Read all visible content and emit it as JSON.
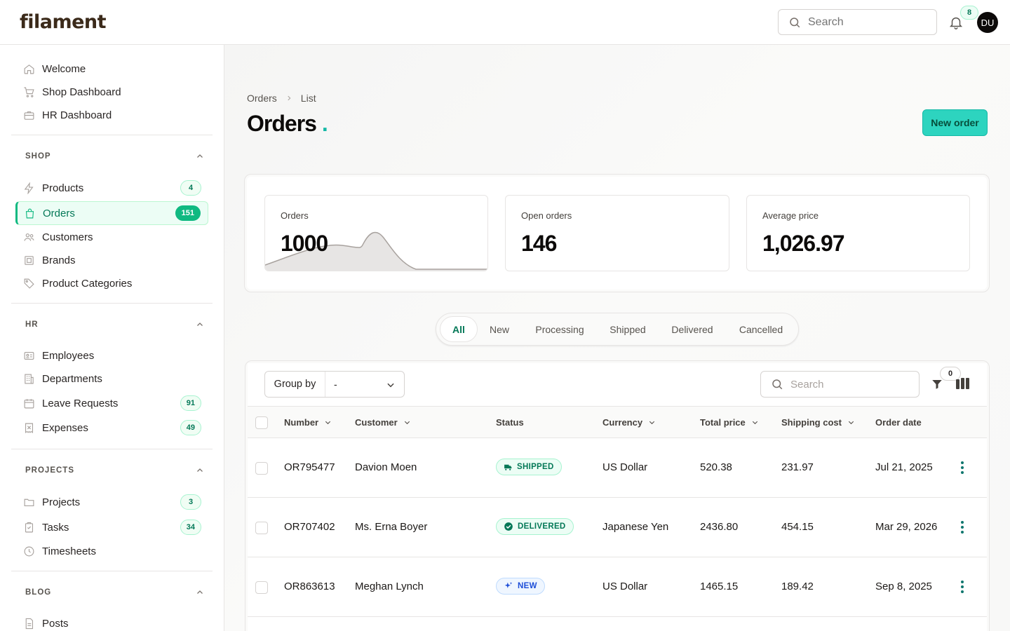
{
  "app": {
    "logo": "filament"
  },
  "topbar": {
    "search_placeholder": "Search",
    "notification_count": "8",
    "avatar_initials": "DU"
  },
  "sidebar": {
    "top_items": [
      {
        "label": "Welcome",
        "icon": "home-icon"
      },
      {
        "label": "Shop Dashboard",
        "icon": "cart-icon"
      },
      {
        "label": "HR Dashboard",
        "icon": "briefcase-icon"
      }
    ],
    "groups": [
      {
        "title": "SHOP",
        "items": [
          {
            "label": "Products",
            "icon": "bolt-icon",
            "badge": "4"
          },
          {
            "label": "Orders",
            "icon": "shopping-bag-icon",
            "badge": "151",
            "active": true
          },
          {
            "label": "Customers",
            "icon": "users-icon"
          },
          {
            "label": "Brands",
            "icon": "tag-square-icon"
          },
          {
            "label": "Product Categories",
            "icon": "tag-icon"
          }
        ]
      },
      {
        "title": "HR",
        "items": [
          {
            "label": "Employees",
            "icon": "id-card-icon"
          },
          {
            "label": "Departments",
            "icon": "building-icon"
          },
          {
            "label": "Leave Requests",
            "icon": "calendar-icon",
            "badge": "91"
          },
          {
            "label": "Expenses",
            "icon": "receipt-icon",
            "badge": "49"
          }
        ]
      },
      {
        "title": "PROJECTS",
        "items": [
          {
            "label": "Projects",
            "icon": "folder-icon",
            "badge": "3"
          },
          {
            "label": "Tasks",
            "icon": "clipboard-icon",
            "badge": "34"
          },
          {
            "label": "Timesheets",
            "icon": "clock-icon"
          }
        ]
      },
      {
        "title": "BLOG",
        "items": [
          {
            "label": "Posts",
            "icon": "document-icon"
          }
        ]
      }
    ]
  },
  "page": {
    "breadcrumbs": [
      "Orders",
      "List"
    ],
    "title": "Orders",
    "title_dot": ".",
    "new_button": "New order"
  },
  "stats": [
    {
      "label": "Orders",
      "value": "1000"
    },
    {
      "label": "Open orders",
      "value": "146"
    },
    {
      "label": "Average price",
      "value": "1,026.97"
    }
  ],
  "tabs": [
    "All",
    "New",
    "Processing",
    "Shipped",
    "Delivered",
    "Cancelled"
  ],
  "active_tab": "All",
  "table": {
    "group_by_label": "Group by",
    "group_by_value": "-",
    "search_placeholder": "Search",
    "filter_count": "0",
    "columns": [
      "Number",
      "Customer",
      "Status",
      "Currency",
      "Total price",
      "Shipping cost",
      "Order date"
    ],
    "rows": [
      {
        "number": "OR795477",
        "customer": "Davion Moen",
        "status": "SHIPPED",
        "currency": "US Dollar",
        "total": "520.38",
        "shipping": "231.97",
        "date": "Jul 21, 2025"
      },
      {
        "number": "OR707402",
        "customer": "Ms. Erna Boyer",
        "status": "DELIVERED",
        "currency": "Japanese Yen",
        "total": "2436.80",
        "shipping": "454.15",
        "date": "Mar 29, 2026"
      },
      {
        "number": "OR863613",
        "customer": "Meghan Lynch",
        "status": "NEW",
        "currency": "US Dollar",
        "total": "1465.15",
        "shipping": "189.42",
        "date": "Sep 8, 2025"
      }
    ]
  },
  "colors": {
    "accent": "#10b981",
    "primary_button": "#2dd4bf",
    "title_dot": "#14b8a6"
  }
}
